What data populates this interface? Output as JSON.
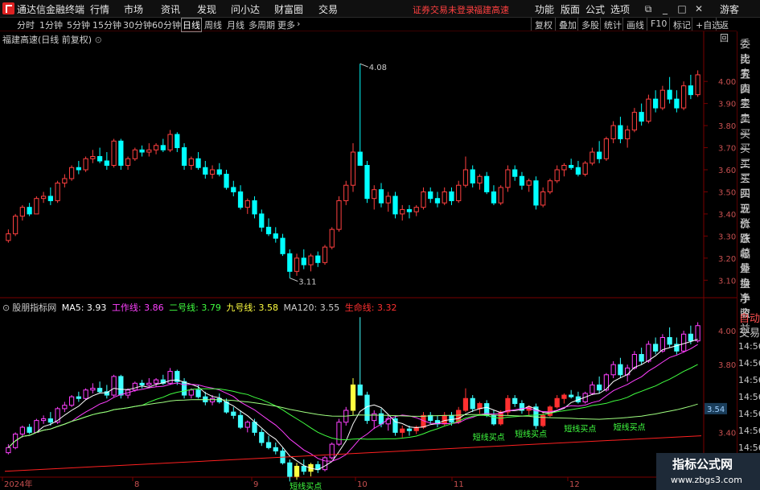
{
  "app": {
    "title": "通达信金融终端"
  },
  "menu": [
    "行情",
    "市场",
    "资讯",
    "发现",
    "问小达",
    "财富圈",
    "交易"
  ],
  "status": {
    "trade_status": "证券交易未登录",
    "stock": "福建高速"
  },
  "right_menu": [
    "功能",
    "版面",
    "公式",
    "选项"
  ],
  "user": "游客",
  "periods": [
    "分时",
    "1分钟",
    "5分钟",
    "15分钟",
    "30分钟",
    "60分钟",
    "日线",
    "周线",
    "月线",
    "多周期",
    "更多"
  ],
  "active_period": "日线",
  "toolbar": [
    "复权",
    "叠加",
    "多股",
    "统计",
    "画线",
    "F10",
    "标记",
    "+自选",
    "返回"
  ],
  "price_panel": {
    "title": "福建高速(日线 前复权)",
    "high_label": "4.08",
    "low_label": "3.11",
    "y_ticks": [
      "4.00",
      "3.90",
      "3.80",
      "3.70",
      "3.60",
      "3.50",
      "3.40",
      "3.30",
      "3.20",
      "3.10"
    ]
  },
  "indicator_panel": {
    "name": "股朋指标网",
    "ma5": "MA5: 3.93",
    "line1": "工作线: 3.86",
    "line2": "二号线: 3.79",
    "line3": "九号线: 3.58",
    "ma120": "MA120: 3.55",
    "line4": "生命线: 3.32",
    "y_ticks": [
      "4.00",
      "3.80",
      "3.40"
    ],
    "current_value": "3.54",
    "signal_label": "短线买点"
  },
  "x_axis": [
    "2024年",
    "8",
    "9",
    "10",
    "11",
    "12"
  ],
  "right_panel": {
    "items": [
      "委比",
      "卖五",
      "卖四",
      "卖三",
      "卖二",
      "卖一",
      "买一",
      "买二",
      "买三",
      "买四",
      "买五",
      "现价",
      "涨跌",
      "涨幅",
      "总量",
      "外盘",
      "换手",
      "净资",
      "收益"
    ],
    "auto": "自动",
    "trade": "交易",
    "times": [
      "14:56",
      "14:56",
      "14:56",
      "14:56",
      "14:56",
      "14:56",
      "14:56",
      "14:56"
    ]
  },
  "watermark": {
    "name": "指标公式网",
    "url": "www.zbgs3.com"
  },
  "colors": {
    "up": "#ff4040",
    "down": "#00ffff",
    "ma5": "#ffffff",
    "line1": "#ff40ff",
    "line2": "#40ff40",
    "line3": "#ffff40",
    "ma120": "#a0a0a0",
    "line4": "#ff2020"
  },
  "chart_data": {
    "type": "candlestick",
    "title": "福建高速(日线 前复权)",
    "ohlc": [
      [
        3.28,
        3.33,
        3.27,
        3.31
      ],
      [
        3.31,
        3.4,
        3.3,
        3.39
      ],
      [
        3.39,
        3.44,
        3.37,
        3.43
      ],
      [
        3.43,
        3.45,
        3.39,
        3.4
      ],
      [
        3.4,
        3.48,
        3.4,
        3.47
      ],
      [
        3.47,
        3.5,
        3.45,
        3.48
      ],
      [
        3.48,
        3.52,
        3.44,
        3.46
      ],
      [
        3.46,
        3.55,
        3.45,
        3.54
      ],
      [
        3.54,
        3.58,
        3.52,
        3.56
      ],
      [
        3.56,
        3.62,
        3.55,
        3.61
      ],
      [
        3.61,
        3.64,
        3.58,
        3.6
      ],
      [
        3.6,
        3.66,
        3.59,
        3.65
      ],
      [
        3.65,
        3.69,
        3.63,
        3.66
      ],
      [
        3.66,
        3.7,
        3.63,
        3.64
      ],
      [
        3.64,
        3.68,
        3.6,
        3.62
      ],
      [
        3.62,
        3.74,
        3.61,
        3.73
      ],
      [
        3.73,
        3.74,
        3.6,
        3.62
      ],
      [
        3.62,
        3.66,
        3.6,
        3.65
      ],
      [
        3.65,
        3.7,
        3.64,
        3.69
      ],
      [
        3.69,
        3.71,
        3.66,
        3.68
      ],
      [
        3.68,
        3.72,
        3.66,
        3.69
      ],
      [
        3.69,
        3.72,
        3.67,
        3.71
      ],
      [
        3.71,
        3.74,
        3.68,
        3.69
      ],
      [
        3.69,
        3.78,
        3.68,
        3.76
      ],
      [
        3.76,
        3.77,
        3.68,
        3.7
      ],
      [
        3.7,
        3.72,
        3.6,
        3.62
      ],
      [
        3.62,
        3.66,
        3.6,
        3.65
      ],
      [
        3.65,
        3.68,
        3.6,
        3.61
      ],
      [
        3.61,
        3.64,
        3.56,
        3.58
      ],
      [
        3.58,
        3.62,
        3.56,
        3.6
      ],
      [
        3.6,
        3.63,
        3.57,
        3.58
      ],
      [
        3.58,
        3.6,
        3.51,
        3.52
      ],
      [
        3.52,
        3.55,
        3.48,
        3.5
      ],
      [
        3.5,
        3.53,
        3.42,
        3.43
      ],
      [
        3.43,
        3.47,
        3.4,
        3.46
      ],
      [
        3.46,
        3.48,
        3.38,
        3.4
      ],
      [
        3.4,
        3.42,
        3.32,
        3.34
      ],
      [
        3.34,
        3.38,
        3.3,
        3.31
      ],
      [
        3.31,
        3.34,
        3.27,
        3.29
      ],
      [
        3.29,
        3.31,
        3.21,
        3.22
      ],
      [
        3.22,
        3.24,
        3.11,
        3.14
      ],
      [
        3.14,
        3.22,
        3.12,
        3.2
      ],
      [
        3.2,
        3.24,
        3.15,
        3.17
      ],
      [
        3.17,
        3.22,
        3.14,
        3.21
      ],
      [
        3.21,
        3.23,
        3.16,
        3.18
      ],
      [
        3.18,
        3.26,
        3.17,
        3.25
      ],
      [
        3.25,
        3.34,
        3.24,
        3.33
      ],
      [
        3.33,
        3.48,
        3.32,
        3.46
      ],
      [
        3.46,
        3.55,
        3.44,
        3.53
      ],
      [
        3.53,
        3.72,
        3.5,
        3.68
      ],
      [
        3.68,
        4.08,
        3.62,
        3.62
      ],
      [
        3.62,
        3.64,
        3.45,
        3.47
      ],
      [
        3.47,
        3.53,
        3.42,
        3.51
      ],
      [
        3.51,
        3.54,
        3.43,
        3.45
      ],
      [
        3.45,
        3.5,
        3.41,
        3.48
      ],
      [
        3.48,
        3.5,
        3.38,
        3.4
      ],
      [
        3.4,
        3.44,
        3.37,
        3.42
      ],
      [
        3.42,
        3.44,
        3.38,
        3.41
      ],
      [
        3.41,
        3.44,
        3.39,
        3.43
      ],
      [
        3.43,
        3.52,
        3.42,
        3.5
      ],
      [
        3.5,
        3.52,
        3.45,
        3.47
      ],
      [
        3.47,
        3.5,
        3.43,
        3.45
      ],
      [
        3.45,
        3.52,
        3.44,
        3.5
      ],
      [
        3.5,
        3.52,
        3.44,
        3.46
      ],
      [
        3.46,
        3.55,
        3.45,
        3.53
      ],
      [
        3.53,
        3.66,
        3.52,
        3.6
      ],
      [
        3.6,
        3.62,
        3.52,
        3.54
      ],
      [
        3.54,
        3.58,
        3.51,
        3.57
      ],
      [
        3.57,
        3.59,
        3.49,
        3.5
      ],
      [
        3.5,
        3.53,
        3.44,
        3.45
      ],
      [
        3.45,
        3.53,
        3.44,
        3.52
      ],
      [
        3.52,
        3.62,
        3.5,
        3.6
      ],
      [
        3.6,
        3.62,
        3.55,
        3.57
      ],
      [
        3.57,
        3.59,
        3.51,
        3.53
      ],
      [
        3.53,
        3.56,
        3.5,
        3.55
      ],
      [
        3.55,
        3.57,
        3.42,
        3.44
      ],
      [
        3.44,
        3.52,
        3.43,
        3.5
      ],
      [
        3.5,
        3.56,
        3.49,
        3.55
      ],
      [
        3.55,
        3.62,
        3.54,
        3.6
      ],
      [
        3.6,
        3.63,
        3.57,
        3.62
      ],
      [
        3.62,
        3.65,
        3.6,
        3.61
      ],
      [
        3.61,
        3.64,
        3.57,
        3.58
      ],
      [
        3.58,
        3.64,
        3.57,
        3.63
      ],
      [
        3.63,
        3.7,
        3.62,
        3.68
      ],
      [
        3.68,
        3.73,
        3.63,
        3.65
      ],
      [
        3.65,
        3.75,
        3.64,
        3.74
      ],
      [
        3.74,
        3.82,
        3.72,
        3.8
      ],
      [
        3.8,
        3.84,
        3.72,
        3.74
      ],
      [
        3.74,
        3.8,
        3.7,
        3.78
      ],
      [
        3.78,
        3.88,
        3.77,
        3.86
      ],
      [
        3.86,
        3.9,
        3.8,
        3.82
      ],
      [
        3.82,
        3.94,
        3.81,
        3.92
      ],
      [
        3.92,
        3.96,
        3.86,
        3.88
      ],
      [
        3.88,
        3.98,
        3.87,
        3.96
      ],
      [
        3.96,
        4.02,
        3.9,
        3.92
      ],
      [
        3.92,
        3.96,
        3.86,
        3.88
      ],
      [
        3.88,
        4.0,
        3.87,
        3.98
      ],
      [
        3.98,
        4.03,
        3.92,
        3.94
      ],
      [
        3.94,
        4.05,
        3.93,
        4.03
      ]
    ],
    "ylim": [
      3.05,
      4.15
    ],
    "x_labels": [
      "2024年",
      "8",
      "9",
      "10",
      "11",
      "12"
    ]
  }
}
